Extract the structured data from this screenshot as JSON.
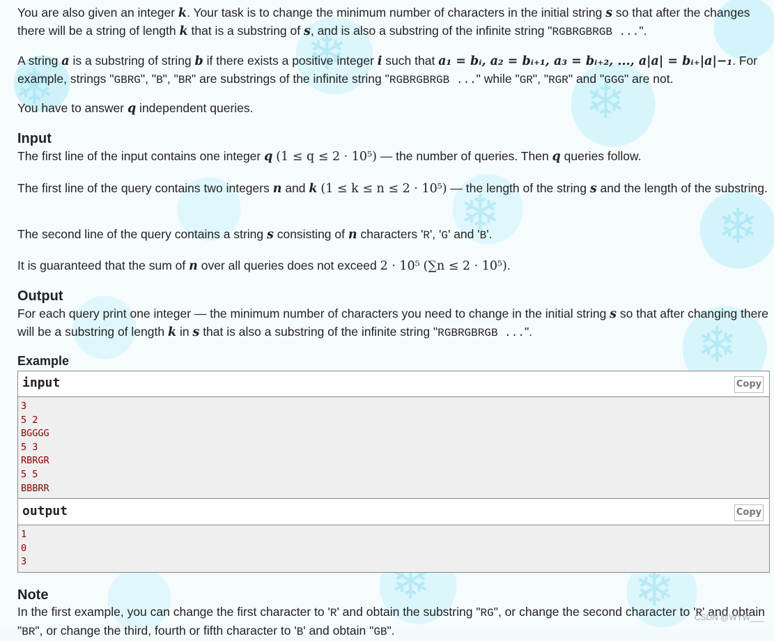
{
  "statement": {
    "p1": {
      "t1": "You are also given an integer ",
      "k": "k",
      "t2": ". Your task is to change the minimum number of characters in the initial string ",
      "s": "s",
      "t3": " so that after the changes there will be a string of length ",
      "k2": "k",
      "t4": " that is a substring of ",
      "s2": "s",
      "t5": ", and is also a substring of the infinite string \"",
      "inf": "RGBRGBRGB ...",
      "t6": "\"."
    },
    "p2": {
      "t1": "A string ",
      "a": "a",
      "t2": " is a substring of string ",
      "b": "b",
      "t3": " if there exists a positive integer ",
      "i": "i",
      "t4": " such that ",
      "formula": "a₁ = bᵢ, a₂ = bᵢ₊₁, a₃ = bᵢ₊₂, ..., a|a| = bᵢ₊|a|−₁",
      "t5": ". For example, strings \"",
      "ex1": "GBRG",
      "t6": "\", \"",
      "ex2": "B",
      "t7": "\", \"",
      "ex3": "BR",
      "t8": "\" are substrings of the infinite string \"",
      "inf": "RGBRGBRGB ...",
      "t9": "\" while \"",
      "nex1": "GR",
      "t10": "\", \"",
      "nex2": "RGR",
      "t11": "\" and \"",
      "nex3": "GGG",
      "t12": "\" are not."
    },
    "p3": {
      "t1": "You have to answer ",
      "q": "q",
      "t2": " independent queries."
    }
  },
  "input_section": {
    "title": "Input",
    "p1": {
      "t1": "The first line of the input contains one integer ",
      "q": "q",
      "constraint": "(1 ≤ q ≤ 2 · 10⁵)",
      "t2": " — the number of queries. Then ",
      "q2": "q",
      "t3": " queries follow."
    },
    "p2": {
      "t1": "The first line of the query contains two integers ",
      "n": "n",
      "t2": " and ",
      "k": "k",
      "constraint": "(1 ≤ k ≤ n ≤ 2 · 10⁵)",
      "t3": " — the length of the string ",
      "s": "s",
      "t4": " and the length of the substring."
    },
    "p3": {
      "t1": "The second line of the query contains a string ",
      "s": "s",
      "t2": " consisting of ",
      "n": "n",
      "t3": " characters '",
      "c1": "R",
      "t4": "', '",
      "c2": "G",
      "t5": "' and '",
      "c3": "B",
      "t6": "'."
    },
    "p4": {
      "t1": "It is guaranteed that the sum of ",
      "n": "n",
      "t2": " over all queries does not exceed ",
      "limit": "2 · 10⁵",
      "constraint": "(∑n ≤ 2 · 10⁵)",
      "t3": "."
    }
  },
  "output_section": {
    "title": "Output",
    "p1": {
      "t1": "For each query print one integer — the minimum number of characters you need to change in the initial string ",
      "s": "s",
      "t2": " so that after changing there will be a substring of length ",
      "k": "k",
      "t3": " in ",
      "s2": "s",
      "t4": " that is also a substring of the infinite string \"",
      "inf": "RGBRGBRGB ...",
      "t5": "\"."
    }
  },
  "example": {
    "title": "Example",
    "input_label": "input",
    "output_label": "output",
    "copy_label": "Copy",
    "input_lines": [
      "3",
      "5 2",
      "BGGGG",
      "5 3",
      "RBRGR",
      "5 5",
      "BBBRR"
    ],
    "output_lines": [
      "1",
      "0",
      "3"
    ]
  },
  "note": {
    "title": "Note",
    "t1": "In the first example, you can change the first character to '",
    "c1": "R",
    "t2": "' and obtain the substring \"",
    "sub1": "RG",
    "t3": "\", or change the second character to '",
    "c2": "R",
    "t4": "' and obtain \"",
    "sub2": "BR",
    "t5": "\", or change the third, fourth or fifth character to '",
    "c3": "B",
    "t6": "' and obtain \"",
    "sub3": "GB",
    "t7": "\"."
  },
  "watermark": "CSDN @WYW___"
}
